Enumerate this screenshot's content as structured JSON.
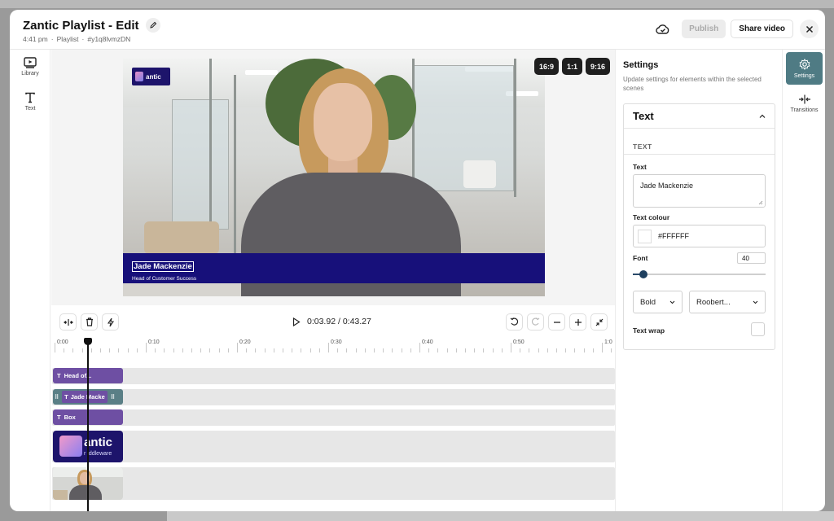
{
  "header": {
    "title": "Zantic Playlist - Edit",
    "time": "4:41 pm",
    "separator": "·",
    "type": "Playlist",
    "id": "#y1q8lvmzDN",
    "publish_label": "Publish",
    "share_label": "Share video"
  },
  "left_rail": [
    {
      "label": "Library",
      "icon": "library-icon"
    },
    {
      "label": "Text",
      "icon": "text-icon"
    }
  ],
  "right_rail": [
    {
      "label": "Settings",
      "icon": "gear-icon",
      "active": true
    },
    {
      "label": "Transitions",
      "icon": "transitions-icon",
      "active": false
    }
  ],
  "canvas": {
    "logo_text": "antic",
    "aspect_ratios": [
      "16:9",
      "1:1",
      "9:16"
    ],
    "lower_third": {
      "name": "Jade Mackenzie",
      "role": "Head of Customer Success",
      "background": "#17107a"
    }
  },
  "playback": {
    "current": "0:03.92",
    "separator": "/",
    "total": "0:43.27"
  },
  "timeline": {
    "ticks": [
      "0:00",
      "0:10",
      "0:20",
      "0:30",
      "0:40",
      "0:50",
      "1:0"
    ],
    "tracks": [
      {
        "label": "Head of..."
      },
      {
        "label": "Jade Macke"
      },
      {
        "label": "Box"
      }
    ],
    "media_logo_text": "antic",
    "media_logo_sub": "r iddleware"
  },
  "settings": {
    "title": "Settings",
    "description": "Update settings for elements within the selected scenes",
    "panel_title": "Text",
    "section_label": "TEXT",
    "text_label": "Text",
    "text_value": "Jade Mackenzie",
    "colour_label": "Text colour",
    "colour_value": "#FFFFFF",
    "font_label": "Font",
    "font_size": "40",
    "font_size_fraction": 0.08,
    "weight_value": "Bold",
    "family_value": "Roobert...",
    "wrap_label": "Text wrap",
    "wrap_checked": false
  },
  "colors": {
    "accent": "#4f7b84",
    "clip": "#6e4fa3",
    "selected_clip": "#5a7f86"
  }
}
